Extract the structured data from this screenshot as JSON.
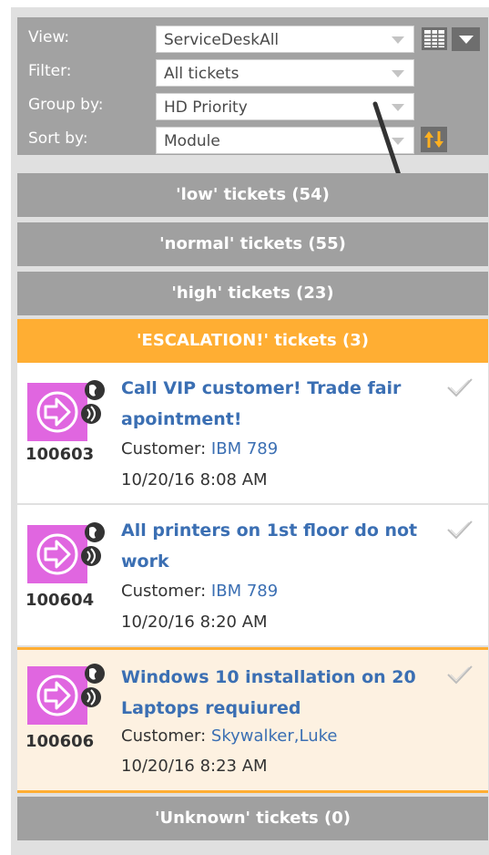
{
  "filters": {
    "view_label": "View:",
    "view_value": "ServiceDeskAll",
    "filter_label": "Filter:",
    "filter_value": "All tickets",
    "group_label": "Group by:",
    "group_value": "HD Priority",
    "sort_label": "Sort by:",
    "sort_value": "Module"
  },
  "groups": {
    "low": "'low' tickets (54)",
    "normal": "'normal' tickets (55)",
    "high": "'high' tickets (23)",
    "escalation": "'ESCALATION!' tickets (3)",
    "unknown": "'Unknown' tickets (0)"
  },
  "tickets": [
    {
      "id": "100603",
      "title": "Call VIP customer! Trade fair apointment!",
      "customer_label": "Customer: ",
      "customer": "IBM 789",
      "date": "10/20/16 8:08 AM"
    },
    {
      "id": "100604",
      "title": "All printers on 1st floor do not work",
      "customer_label": "Customer: ",
      "customer": "IBM 789",
      "date": "10/20/16 8:20 AM"
    },
    {
      "id": "100606",
      "title": "Windows 10 installation on 20 Laptops requiured",
      "customer_label": "Customer: ",
      "customer": "Skywalker,Luke",
      "date": "10/20/16 8:23 AM"
    }
  ],
  "colors": {
    "accent": "#ffae33",
    "header_gray": "#a0a0a0",
    "link": "#3b6fb3",
    "tile": "#e066e0"
  },
  "icons": [
    "arrow-tile-icon",
    "globe-icon",
    "sound-icon",
    "checkmark-icon",
    "grid-view-icon",
    "dropdown-icon",
    "sort-toggle-icon"
  ]
}
